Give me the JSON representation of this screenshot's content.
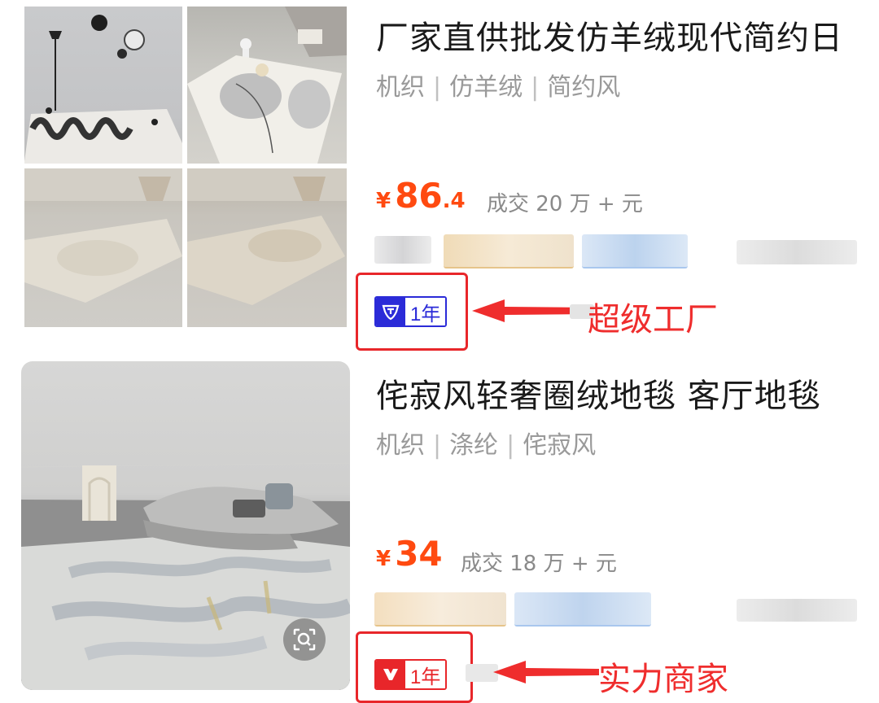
{
  "products": [
    {
      "title": "厂家直供批发仿羊绒现代简约日",
      "attributes": [
        "机织",
        "仿羊绒",
        "简约风"
      ],
      "price": {
        "currency": "¥",
        "integer": "86",
        "decimal": ".4"
      },
      "sales": "成交 20 万 + 元",
      "badge": {
        "icon": "shield-check-icon",
        "years": "1年",
        "color": "#2b2bd8"
      },
      "annotation": "超级工厂"
    },
    {
      "title": "侘寂风轻奢圈绒地毯 客厅地毯",
      "attributes": [
        "机织",
        "涤纶",
        "侘寂风"
      ],
      "price": {
        "currency": "¥",
        "integer": "34",
        "decimal": ""
      },
      "sales": "成交 18 万 + 元",
      "badge": {
        "icon": "strength-merchant-icon",
        "years": "1年",
        "color": "#e8262a"
      },
      "annotation": "实力商家"
    }
  ],
  "colors": {
    "price": "#ff4a10",
    "annotation": "#ef2d2d",
    "attributes": "#9a9a9a"
  }
}
